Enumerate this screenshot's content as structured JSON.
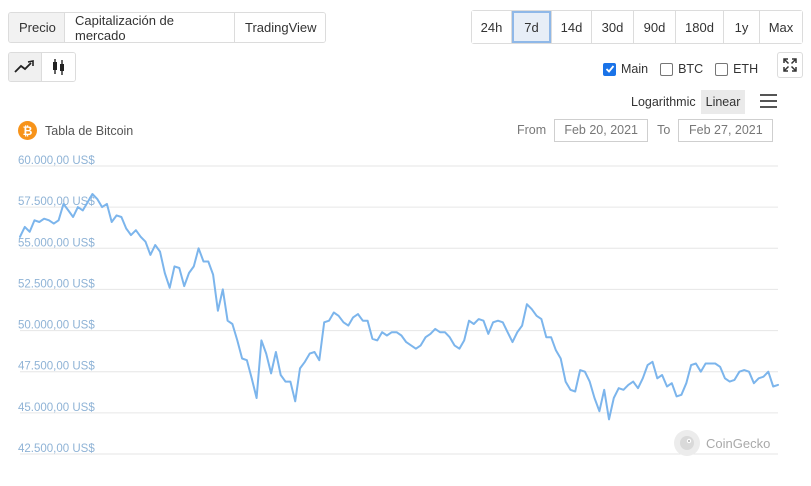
{
  "tabs": [
    {
      "label": "Precio",
      "active": true
    },
    {
      "label": "Capitalización de mercado",
      "active": false
    },
    {
      "label": "TradingView",
      "active": false
    }
  ],
  "ranges": [
    {
      "label": "24h",
      "active": false
    },
    {
      "label": "7d",
      "active": true
    },
    {
      "label": "14d",
      "active": false
    },
    {
      "label": "30d",
      "active": false
    },
    {
      "label": "90d",
      "active": false
    },
    {
      "label": "180d",
      "active": false
    },
    {
      "label": "1y",
      "active": false
    },
    {
      "label": "Max",
      "active": false
    }
  ],
  "chart_types": [
    {
      "icon": "line-chart-icon",
      "active": true
    },
    {
      "icon": "candlestick-icon",
      "active": false
    }
  ],
  "compare": [
    {
      "label": "Main",
      "checked": true
    },
    {
      "label": "BTC",
      "checked": false
    },
    {
      "label": "ETH",
      "checked": false
    }
  ],
  "scale": {
    "logarithmic": "Logarithmic",
    "linear": "Linear",
    "active": "linear"
  },
  "coin": {
    "logo_symbol": "₿",
    "title": "Tabla de Bitcoin",
    "color": "#f7931a"
  },
  "dates": {
    "from_label": "From",
    "from_value": "Feb 20, 2021",
    "to_label": "To",
    "to_value": "Feb 27, 2021"
  },
  "watermark": "CoinGecko",
  "accent": "#1a73e8",
  "chart_data": {
    "type": "line",
    "title": "Tabla de Bitcoin",
    "xlabel": "",
    "ylabel": "",
    "ylim": [
      42500,
      60000
    ],
    "yticks": [
      60000,
      57500,
      55000,
      52500,
      50000,
      47500,
      45000,
      42500
    ],
    "ytick_labels": [
      "60.000,00 US$",
      "57.500,00 US$",
      "55.000,00 US$",
      "52.500,00 US$",
      "50.000,00 US$",
      "47.500,00 US$",
      "45.000,00 US$",
      "42.500,00 US$"
    ],
    "grid": true,
    "line_color": "#7cb5ec",
    "x_start": "2021-02-20",
    "x_end": "2021-02-27",
    "values": [
      55700,
      56300,
      56000,
      56700,
      56600,
      56800,
      56700,
      56500,
      56700,
      57700,
      57300,
      56900,
      57500,
      57300,
      57800,
      58300,
      58000,
      57500,
      57700,
      56600,
      57000,
      56900,
      56200,
      55800,
      56100,
      55700,
      55400,
      54600,
      55200,
      54800,
      53500,
      52600,
      53900,
      53800,
      52700,
      53500,
      53900,
      55000,
      54200,
      54200,
      53400,
      51200,
      52500,
      50600,
      50400,
      49400,
      48300,
      48200,
      47100,
      45900,
      49400,
      48600,
      47400,
      48700,
      47300,
      46900,
      46900,
      45700,
      47700,
      48100,
      48600,
      48700,
      48200,
      50500,
      50600,
      51100,
      50900,
      50500,
      50300,
      50800,
      51000,
      50600,
      50600,
      49500,
      49400,
      49900,
      49700,
      49900,
      49900,
      49700,
      49300,
      49100,
      48900,
      49100,
      49600,
      49800,
      50100,
      49900,
      49900,
      49600,
      49100,
      48900,
      49400,
      50600,
      50400,
      50700,
      50600,
      49800,
      50500,
      50600,
      50500,
      49900,
      49300,
      49900,
      50300,
      51600,
      51300,
      50900,
      50700,
      49600,
      49600,
      48800,
      48300,
      46900,
      46400,
      46300,
      47600,
      47500,
      46900,
      45900,
      45100,
      46400,
      44600,
      45900,
      46500,
      46400,
      46700,
      46900,
      46500,
      47100,
      47900,
      48100,
      47100,
      47300,
      46600,
      46800,
      46000,
      46100,
      46800,
      47900,
      48000,
      47500,
      48000,
      48000,
      48000,
      47800,
      47100,
      46900,
      47000,
      47500,
      47600,
      47500,
      46800,
      47100,
      47200,
      47500,
      46600,
      46700
    ]
  }
}
